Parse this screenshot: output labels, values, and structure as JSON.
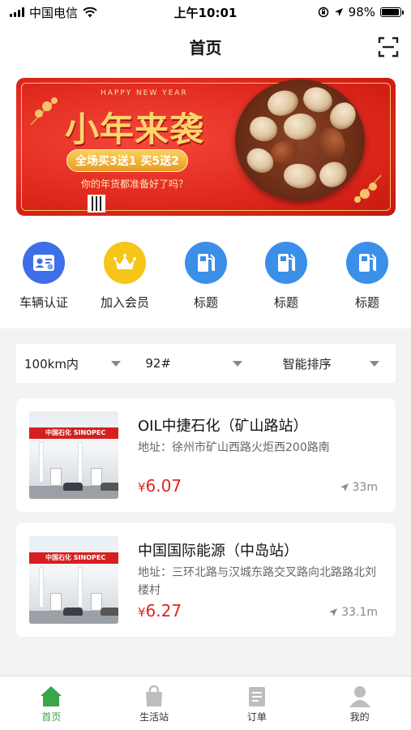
{
  "status_bar": {
    "carrier": "中国电信",
    "time": "上午10:01",
    "battery_percent": "98%",
    "battery_level": 0.98
  },
  "nav": {
    "title": "首页",
    "scan_icon": "scan-icon"
  },
  "banner": {
    "greeting": "HAPPY NEW YEAR",
    "title": "小年来袭",
    "promo": "全场买3送1 买5送2",
    "subtitle": "你的年货都准备好了吗？",
    "colors": {
      "background": "#e12a1f",
      "gold": "#ffd46e"
    }
  },
  "quick_actions": [
    {
      "label": "车辆认证",
      "icon": "id-card-icon",
      "color": "#3f6fe8"
    },
    {
      "label": "加入会员",
      "icon": "crown-icon",
      "color": "#f5c518"
    },
    {
      "label": "标题",
      "icon": "fuel-pump-icon",
      "color": "#3c8fe8"
    },
    {
      "label": "标题",
      "icon": "fuel-pump-icon",
      "color": "#3c8fe8"
    },
    {
      "label": "标题",
      "icon": "fuel-pump-icon",
      "color": "#3c8fe8"
    }
  ],
  "filters": [
    {
      "label": "100km内"
    },
    {
      "label": "92#"
    },
    {
      "label": "智能排序"
    }
  ],
  "stations": [
    {
      "name": "OIL中捷石化（矿山路站）",
      "address": "地址：徐州市矿山西路火炬西200路南",
      "currency": "¥",
      "price": "6.07",
      "distance": "33m",
      "sign_text": "中国石化 SINOPEC"
    },
    {
      "name": "中国国际能源（中岛站）",
      "address": "地址：三环北路与汉城东路交叉路向北路路北刘楼村",
      "currency": "¥",
      "price": "6.27",
      "distance": "33.1m",
      "sign_text": "中国石化 SINOPEC"
    }
  ],
  "tab_bar": [
    {
      "label": "首页",
      "icon": "home-icon",
      "active": true
    },
    {
      "label": "生活站",
      "icon": "shopping-bag-icon",
      "active": false
    },
    {
      "label": "订单",
      "icon": "order-list-icon",
      "active": false
    },
    {
      "label": "我的",
      "icon": "user-icon",
      "active": false
    }
  ],
  "colors": {
    "accent_green": "#3aa648",
    "price_red": "#e02424",
    "page_bg": "#f3f3f3"
  }
}
